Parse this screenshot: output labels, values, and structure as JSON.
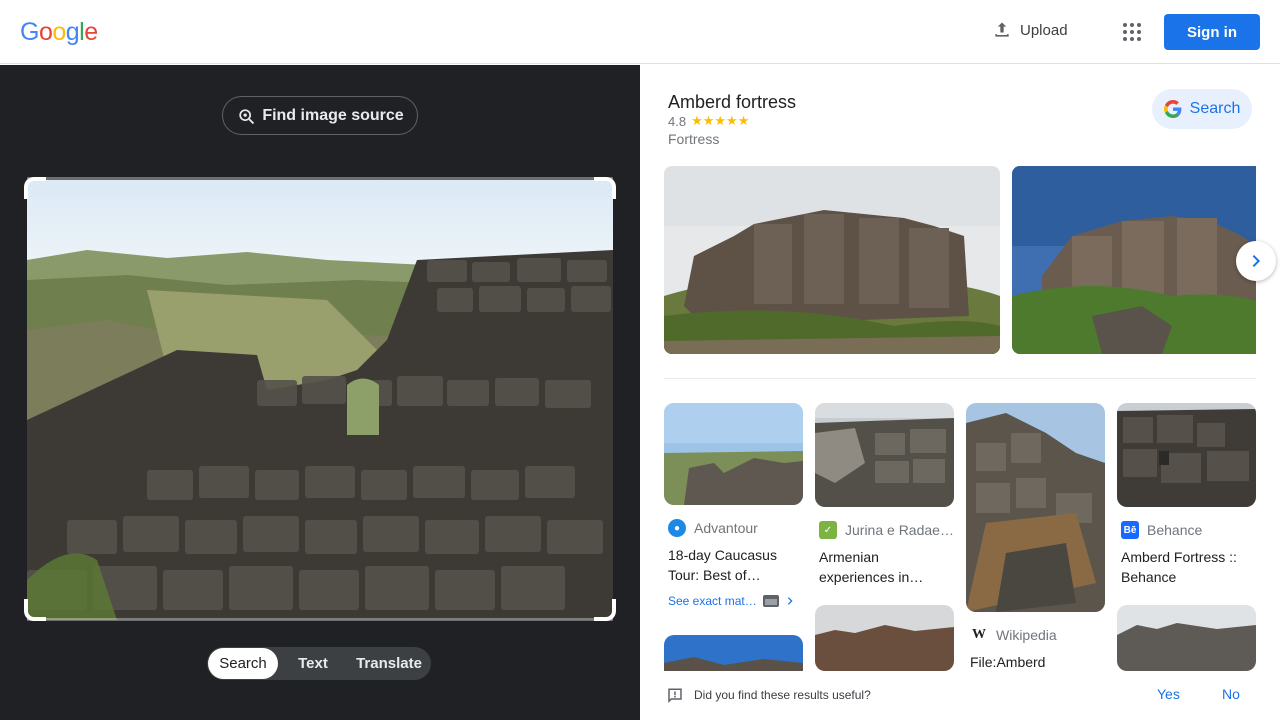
{
  "header": {
    "logo_letters": [
      "G",
      "o",
      "o",
      "g",
      "l",
      "e"
    ],
    "logo_colors": [
      "#4285F4",
      "#EA4335",
      "#FBBC05",
      "#4285F4",
      "#34A853",
      "#EA4335"
    ],
    "upload_label": "Upload",
    "signin_label": "Sign in"
  },
  "left_panel": {
    "find_source_label": "Find image source",
    "tabs": [
      {
        "label": "Search",
        "active": true
      },
      {
        "label": "Text",
        "active": false
      },
      {
        "label": "Translate",
        "active": false
      }
    ]
  },
  "knowledge_panel": {
    "title": "Amberd fortress",
    "rating": "4.8",
    "stars": "★★★★★",
    "type": "Fortress",
    "search_label": "Search"
  },
  "results": [
    {
      "source": "Advantour",
      "title": "18-day Caucasus Tour: Best of…",
      "exact_label": "See exact mat…",
      "favicon_color": "#1e88e5"
    },
    {
      "source": "Jurina e Radae…",
      "title": "Armenian experiences in…",
      "favicon_color": "#7cb342"
    },
    {
      "source": "Wikipedia",
      "title": "File:Amberd",
      "favicon_text": "W"
    },
    {
      "source": "Behance",
      "title": "Amberd Fortress :: Behance",
      "favicon_text": "Bē",
      "favicon_color": "#1769ff"
    }
  ],
  "feedback": {
    "question": "Did you find these results useful?",
    "yes": "Yes",
    "no": "No"
  }
}
